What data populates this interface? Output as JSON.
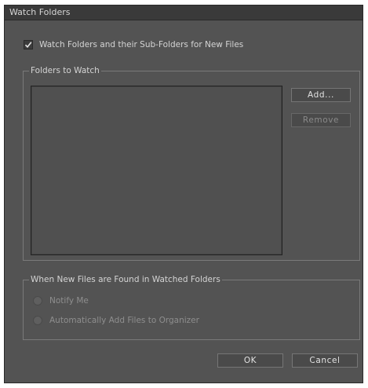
{
  "dialog": {
    "title": "Watch Folders"
  },
  "watch_option": {
    "label": "Watch Folders and their Sub-Folders for New Files",
    "checked": true
  },
  "folders_group": {
    "legend": "Folders to Watch",
    "add_button": "Add...",
    "remove_button": "Remove",
    "folders": []
  },
  "found_group": {
    "legend": "When New Files are Found in Watched Folders",
    "options": [
      {
        "label": "Notify Me"
      },
      {
        "label": "Automatically Add Files to Organizer"
      }
    ]
  },
  "footer": {
    "ok_button": "OK",
    "cancel_button": "Cancel"
  },
  "icons": {
    "checkbox_check": "check-icon"
  },
  "colors": {
    "dialog_bg": "#535353",
    "titlebar_bg": "#3a3a3a",
    "text": "#d4d4d4",
    "disabled_text": "#8e8e8e"
  }
}
